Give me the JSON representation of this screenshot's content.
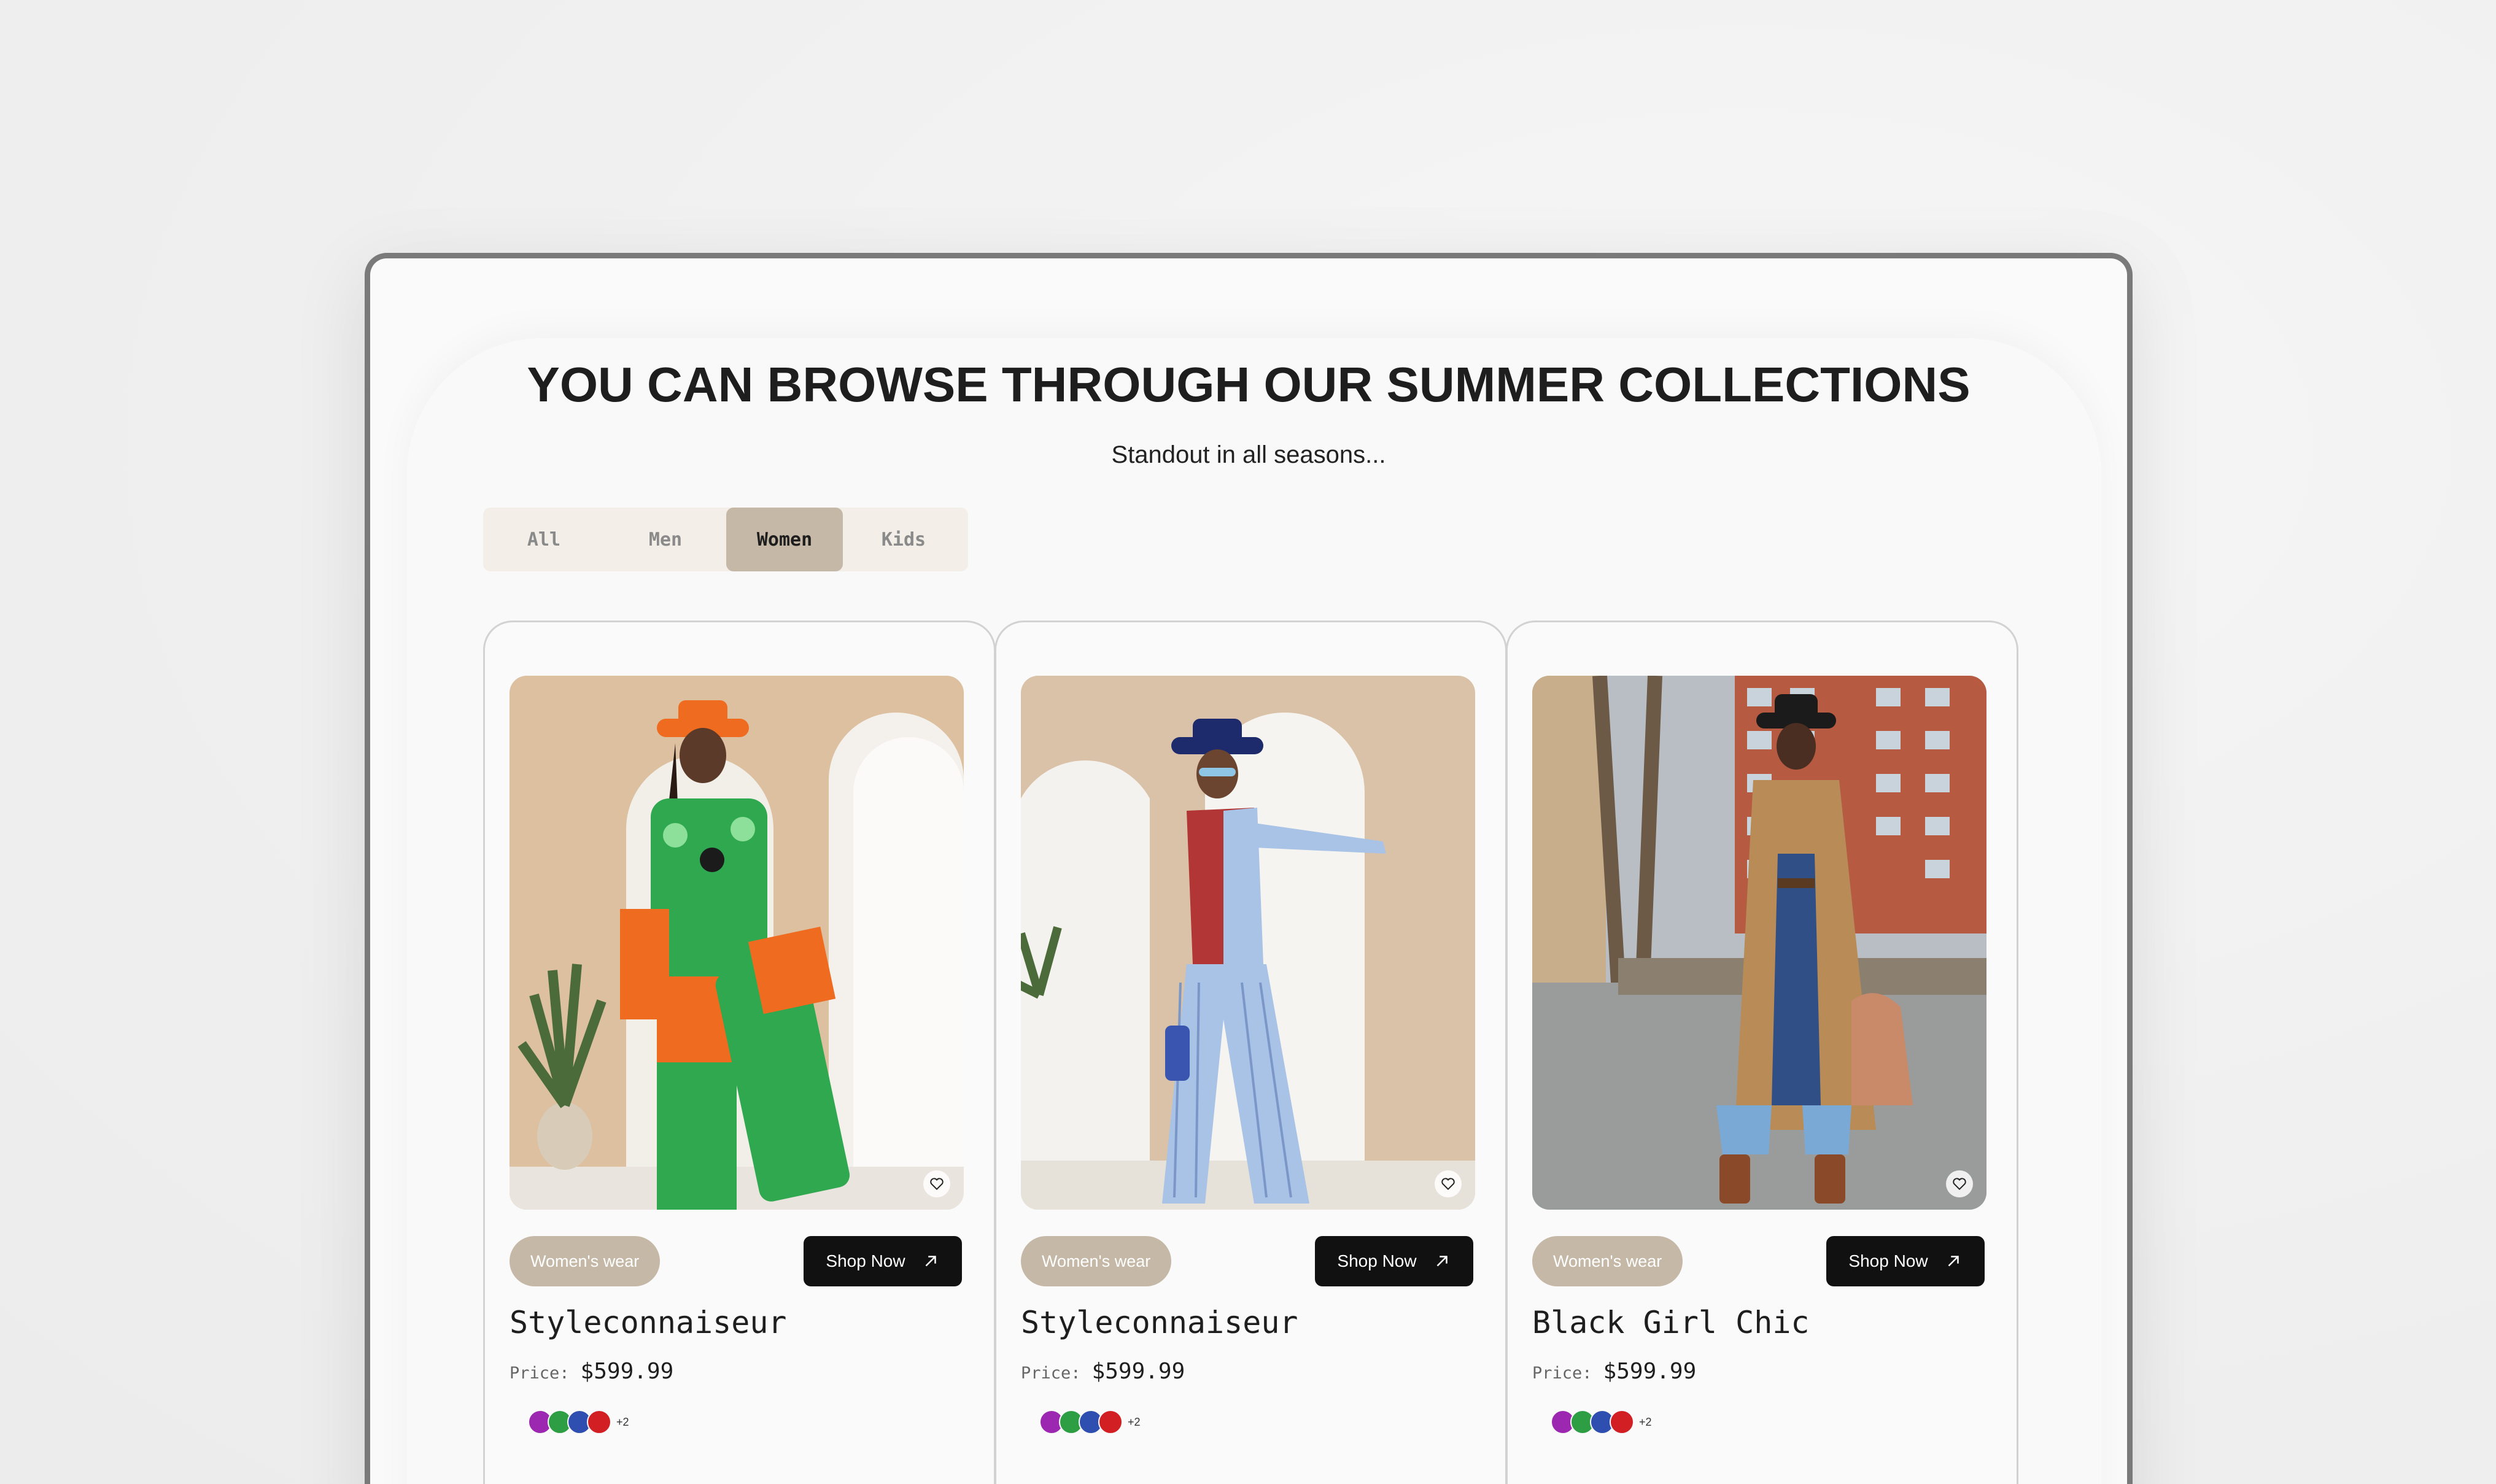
{
  "header": {
    "headline": "YOU CAN BROWSE THROUGH OUR SUMMER COLLECTIONS",
    "subline": "Standout in all seasons..."
  },
  "tabs": [
    {
      "label": "All",
      "active": false
    },
    {
      "label": "Men",
      "active": false
    },
    {
      "label": "Women",
      "active": true
    },
    {
      "label": "Kids",
      "active": false
    }
  ],
  "products": [
    {
      "tag": "Women's wear",
      "shop_label": "Shop Now",
      "title": "Styleconnaiseur",
      "price_label": "Price:",
      "price": "$599.99",
      "more_colors": "+2"
    },
    {
      "tag": "Women's wear",
      "shop_label": "Shop Now",
      "title": "Styleconnaiseur",
      "price_label": "Price:",
      "price": "$599.99",
      "more_colors": "+2"
    },
    {
      "tag": "Women's wear",
      "shop_label": "Shop Now",
      "title": "Black Girl Chic",
      "price_label": "Price:",
      "price": "$599.99",
      "more_colors": "+2"
    }
  ],
  "colors": {
    "swatches": [
      "#9c27b0",
      "#2e9e44",
      "#2f4fb0",
      "#d11f24"
    ],
    "accent": "#c5b8a6",
    "button": "#111111"
  },
  "icons": {
    "favorite": "heart-icon",
    "shop": "arrow-up-right-icon"
  }
}
